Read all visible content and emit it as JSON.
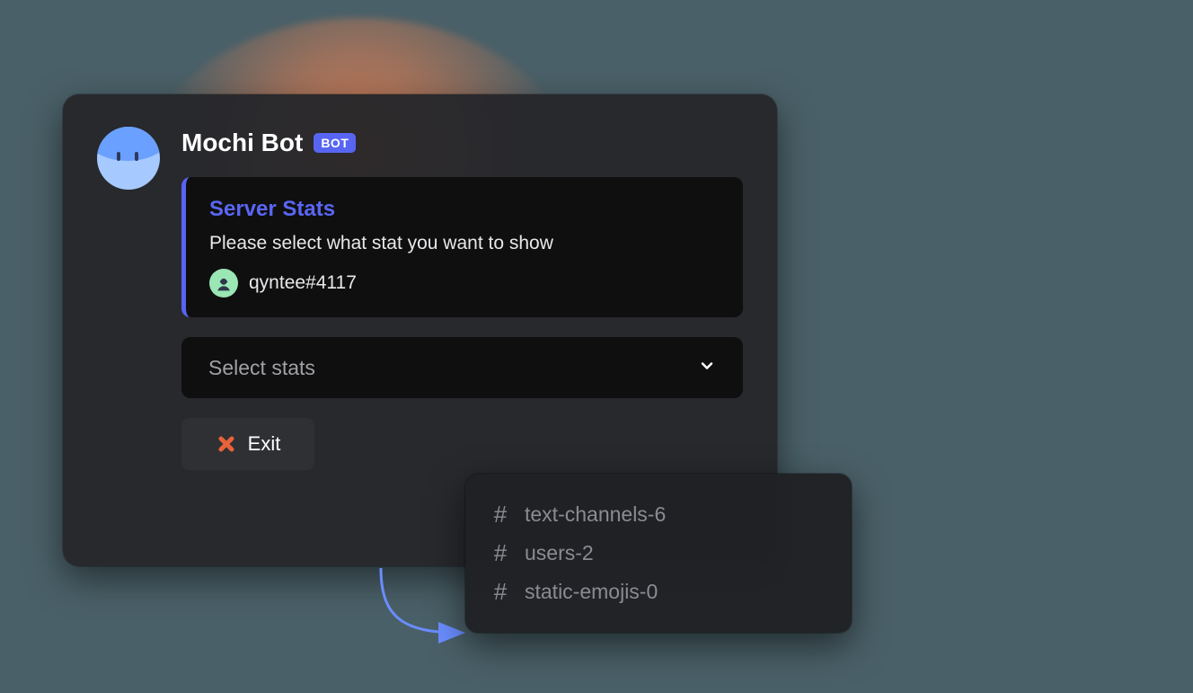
{
  "bot": {
    "name": "Mochi Bot",
    "badge": "BOT"
  },
  "embed": {
    "title": "Server Stats",
    "description": "Please select what stat you want to show",
    "user_tag": "qyntee#4117"
  },
  "select": {
    "placeholder": "Select stats"
  },
  "exit": {
    "label": "Exit"
  },
  "channels": [
    {
      "name": "text-channels-6"
    },
    {
      "name": "users-2"
    },
    {
      "name": "static-emojis-0"
    }
  ],
  "icons": {
    "hash": "#"
  }
}
